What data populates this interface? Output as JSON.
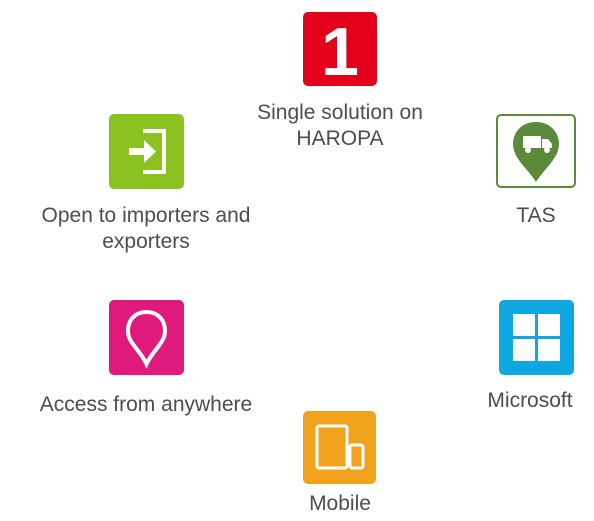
{
  "colors": {
    "one_tile": "#e3001b",
    "tas_border": "#5b8a3a",
    "open_tile": "#8cc220",
    "access_tile": "#e0197d",
    "microsoft_tile": "#0ea7e2",
    "mobile_tile": "#f0a21d",
    "label_text": "#4d4d4d"
  },
  "features": {
    "single_solution": {
      "icon": "number-one-icon",
      "glyph": "1",
      "line1": "Single solution on",
      "line2": "HAROPA"
    },
    "tas": {
      "icon": "truck-pin-icon",
      "line1": "TAS"
    },
    "open": {
      "icon": "sign-in-icon",
      "line1": "Open to importers and",
      "line2": "exporters"
    },
    "access": {
      "icon": "location-pin-icon",
      "line1": "Access from anywhere"
    },
    "microsoft": {
      "icon": "windows-logo-icon",
      "line1": "Microsoft"
    },
    "mobile": {
      "icon": "tablet-phone-icon",
      "line1": "Mobile"
    }
  }
}
